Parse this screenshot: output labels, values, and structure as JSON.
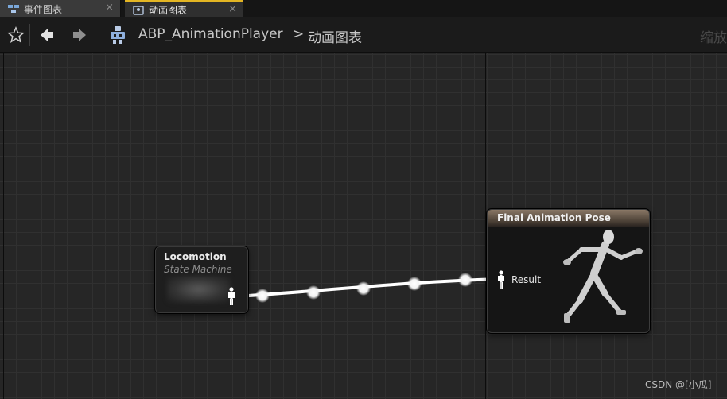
{
  "tabs": [
    {
      "label": "事件图表",
      "icon": "event-graph-icon",
      "active": false
    },
    {
      "label": "动画图表",
      "icon": "anim-graph-icon",
      "active": true
    }
  ],
  "toolbar": {
    "breadcrumb_root": "ABP_AnimationPlayer",
    "breadcrumb_separator": ">",
    "breadcrumb_current": "动画图表",
    "zoom_label": "缩放"
  },
  "nodes": {
    "locomotion": {
      "title": "Locomotion",
      "subtitle": "State Machine"
    },
    "final_pose": {
      "title": "Final Animation Pose",
      "result_label": "Result"
    }
  },
  "watermark": "CSDN @[小瓜]",
  "colors": {
    "active_tab_accent": "#e3b523",
    "canvas_bg": "#262626",
    "wire": "#ffffff",
    "final_header": "#8a7866"
  }
}
